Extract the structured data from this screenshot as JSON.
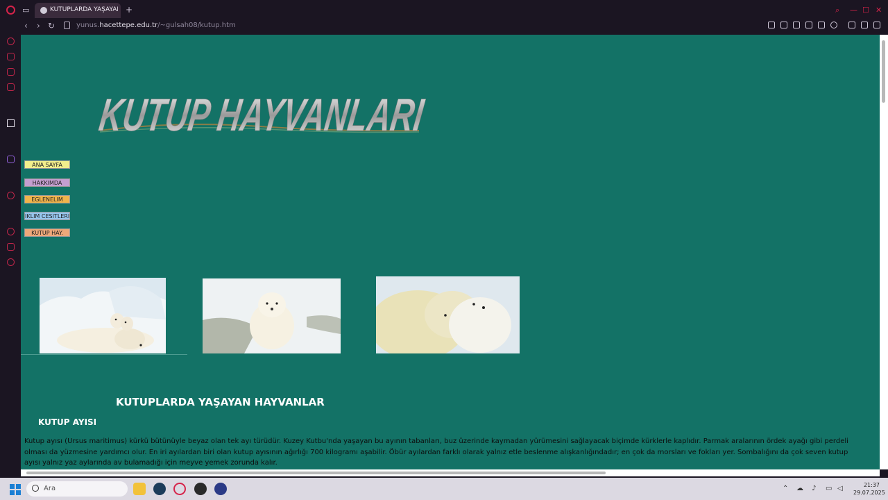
{
  "browser": {
    "tab_title": "KUTUPLARDA YAŞAYAN H",
    "url_prefix": "yunus.",
    "url_host": "hacettepe.edu.tr",
    "url_path": "/~gulsah08/kutup.htm"
  },
  "page": {
    "logo_text": "KUTUP HAYVANLARI",
    "menu": [
      {
        "label": "ANA SAYFA",
        "color": "#f2ee8c"
      },
      {
        "label": "HAKKIMDA",
        "color": "#c59fd0"
      },
      {
        "label": "EGLENELIM",
        "color": "#f0b44c"
      },
      {
        "label": "IKLIM CESITLERI",
        "color": "#96c6ee"
      },
      {
        "label": "KUTUP HAY.",
        "color": "#eea87a"
      }
    ],
    "heading": "KUTUPLARDA YAŞAYAN HAYVANLAR",
    "section_title": "KUTUP AYISI",
    "paragraph": "Kutup ayısı (Ursus maritimus) kürkü bütünüyle beyaz olan tek ayı türüdür. Kuzey Kutbu'nda yaşayan bu ayının tabanları, buz üzerinde kaymadan yürümesini sağlayacak biçimde kürklerle kaplıdır. Parmak aralarının ördek ayağı gibi perdeli olması da yüzmesine yardımcı olur. En iri ayılardan biri olan kutup ayısının ağırlığı 700 kilogramı aşabilir. Öbür ayılardan farklı olarak yalnız etle beslenme alışkanlığındadır; en çok da morsları ve fokları yer. Sombalığını da çok seven kutup ayısı yalnız yaz aylarında av bulamadığı için meyve yemek zorunda kalır."
  },
  "taskbar": {
    "search_placeholder": "Ara",
    "time": "21:37",
    "date": "29.07.2025"
  },
  "colors": {
    "page_bg": "#137266",
    "browser_bg": "#1b1522",
    "accent": "#d6234a"
  }
}
